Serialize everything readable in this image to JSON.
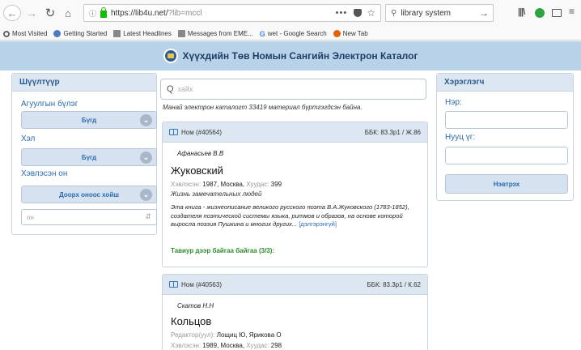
{
  "browser": {
    "url_host": "https://lib4u.net/",
    "url_path": "?lib=mccl",
    "search_value": "library system",
    "bookmarks": [
      {
        "label": "Most Visited",
        "icon": "gear-icon"
      },
      {
        "label": "Getting Started",
        "icon": "globe-icon"
      },
      {
        "label": "Latest Headlines",
        "icon": "rss-icon"
      },
      {
        "label": "Messages from EME...",
        "icon": "rss-icon"
      },
      {
        "label": "wet - Google Search",
        "icon": "google-icon"
      },
      {
        "label": "New Tab",
        "icon": "firefox-icon"
      }
    ]
  },
  "header": {
    "title": "Хүүхдийн Төв Номын Сангийн Электрон Каталог"
  },
  "filters": {
    "title": "Шүүлтүүр",
    "groups": [
      {
        "label": "Агуулгын бүлэг",
        "value": "Бүгд"
      },
      {
        "label": "Хэл",
        "value": "Бүгд"
      },
      {
        "label": "Хэвлэсэн он",
        "value": "Доорх оноос хойш"
      }
    ],
    "year_placeholder": "он"
  },
  "search": {
    "placeholder": "хайх",
    "catalog_info": "Манай электрон каталогт 33419 материал бүртгэгдсэн байна."
  },
  "records": [
    {
      "type": "Ном",
      "id": "(#40564)",
      "bbk": "ББК: 83.3р1 / Ж.86",
      "author": "Афанасьев В.В",
      "title": "Жуковский",
      "published_label": "Хэвлэсэн:",
      "published_value": "1987, Москва,",
      "pages_label": "Хуудас:",
      "pages_value": "399",
      "series": "Жизнь замечательных людей",
      "description": "Эта книга - жизнеописание великого русского поэта В.А.Жуковского (1783-1852), создателя поэтической системы языка, ритмов и образов, на основе которой выросла поэзия Пушкина и многих других...",
      "more": "[дэлгэрэнгүй]",
      "location": "Тавиур дээр байгаа байгаа (3/3):"
    },
    {
      "type": "Ном",
      "id": "(#40563)",
      "bbk": "ББК: 83.3р1 / К.62",
      "author": "Скатов Н.Н",
      "title": "Кольцов",
      "editor_label": "Редактор(уул):",
      "editor_value": "Лощиц Ю, Ярикова О",
      "published_label": "Хэвлэсэн:",
      "published_value": "1989, Москва,",
      "pages_label": "Хуудас:",
      "pages_value": "298"
    }
  ],
  "user": {
    "title": "Хэрэглэгч",
    "name_label": "Нэр:",
    "password_label": "Нууц үг:",
    "login_label": "Нэвтрэх"
  }
}
